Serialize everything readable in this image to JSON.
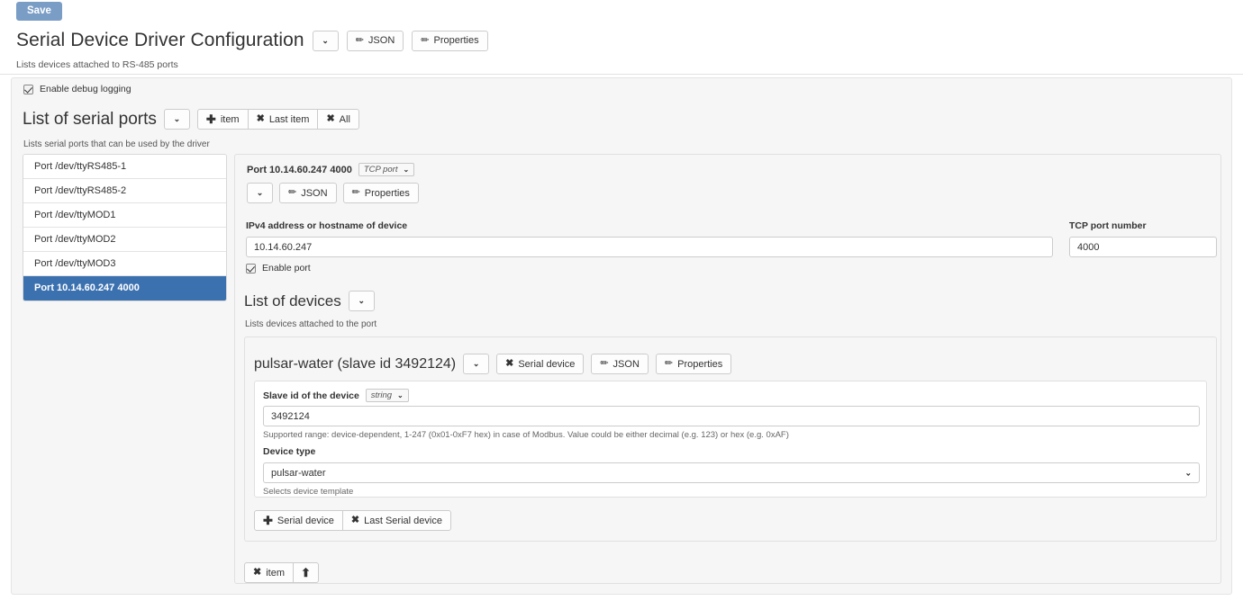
{
  "toolbar": {
    "save_label": "Save"
  },
  "root": {
    "title": "Serial Device Driver Configuration",
    "description": "Lists devices attached to RS-485 ports",
    "json_label": "JSON",
    "properties_label": "Properties"
  },
  "debug": {
    "label": "Enable debug logging",
    "checked": true
  },
  "serial_ports": {
    "title": "List of serial ports",
    "description": "Lists serial ports that can be used by the driver",
    "add_item_label": "item",
    "last_item_label": "Last item",
    "all_label": "All",
    "items": [
      {
        "label": "Port /dev/ttyRS485-1",
        "selected": false
      },
      {
        "label": "Port /dev/ttyRS485-2",
        "selected": false
      },
      {
        "label": "Port /dev/ttyMOD1",
        "selected": false
      },
      {
        "label": "Port /dev/ttyMOD2",
        "selected": false
      },
      {
        "label": "Port /dev/ttyMOD3",
        "selected": false
      },
      {
        "label": "Port 10.14.60.247 4000",
        "selected": true
      }
    ]
  },
  "port_detail": {
    "title": "Port 10.14.60.247 4000",
    "type_badge": "TCP port",
    "json_label": "JSON",
    "properties_label": "Properties",
    "ipv4_label": "IPv4 address or hostname of device",
    "ipv4_value": "10.14.60.247",
    "tcp_port_label": "TCP port number",
    "tcp_port_value": "4000",
    "enable_port_label": "Enable port",
    "enable_port_checked": true
  },
  "devices": {
    "title": "List of devices",
    "description": "Lists devices attached to the port",
    "device": {
      "title": "pulsar-water (slave id 3492124)",
      "remove_label": "Serial device",
      "json_label": "JSON",
      "properties_label": "Properties",
      "slave_id_label": "Slave id of the device",
      "slave_id_type": "string",
      "slave_id_value": "3492124",
      "slave_id_hint": "Supported range: device-dependent, 1-247 (0x01-0xF7 hex) in case of Modbus. Value could be either decimal (e.g. 123) or hex (e.g. 0xAF)",
      "device_type_label": "Device type",
      "device_type_value": "pulsar-water",
      "device_type_hint": "Selects device template",
      "add_device_label": "Serial device",
      "last_device_label": "Last Serial device"
    }
  },
  "panel_footer": {
    "remove_item_label": "item",
    "move_up_label": "↑"
  },
  "icons": {
    "caret_down": "⌄",
    "pencil": "✏",
    "cross": "✖",
    "plus": "✚",
    "up_arrow": "⬆"
  },
  "colors": {
    "save_button": "#7a9dc6",
    "selected_item": "#3c71b0",
    "card_background": "#f6f6f6",
    "border": "#e0e0e0"
  }
}
